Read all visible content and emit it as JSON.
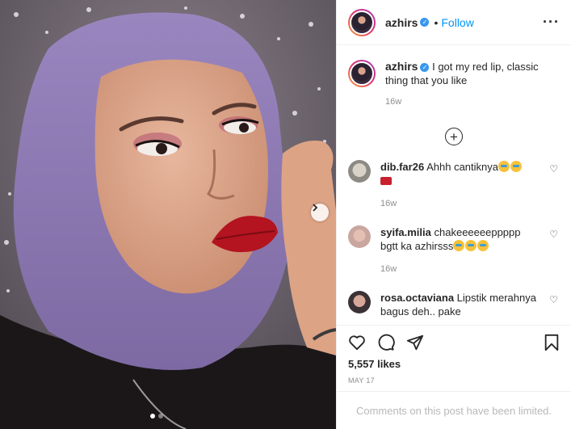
{
  "post": {
    "username": "azhirs",
    "separator": "•",
    "follow_label": "Follow",
    "more_icon": "more-options-icon"
  },
  "caption": {
    "username": "azhirs",
    "text": "I got my red lip, classic thing that you like",
    "time": "16w"
  },
  "comments": [
    {
      "username": "dib.far26",
      "text": "Ahhh cantiknya",
      "time": "16w"
    },
    {
      "username": "syifa.milia",
      "text": "chakeeeeeeppppp bgtt ka azhirsss",
      "time": "16w"
    },
    {
      "username": "rosa.octaviana",
      "text": "Lipstik merahnya bagus deh.. pake",
      "time": ""
    }
  ],
  "likes": "5,557 likes",
  "date": "MAY 17",
  "limited_notice": "Comments on this post have been limited.",
  "colors": {
    "accent": "#0095f6",
    "verified": "#3897f0",
    "muted": "#8e8e8e",
    "photo_background": "#6e6770",
    "hijab": "#8b76b0",
    "lip": "#b3141f"
  },
  "carousel": {
    "slides": 2,
    "active": 0
  }
}
